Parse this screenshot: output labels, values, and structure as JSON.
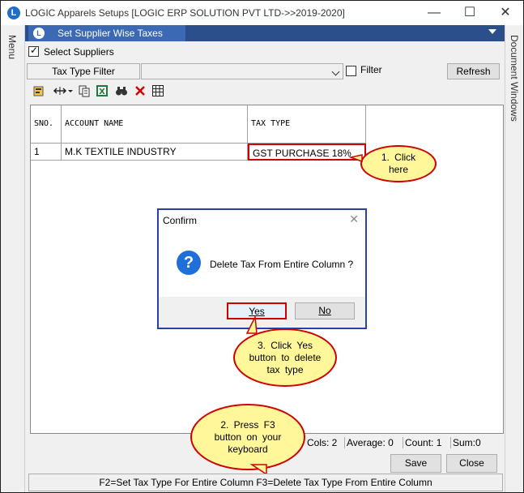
{
  "window": {
    "title": "LOGIC Apparels Setups  [LOGIC ERP SOLUTION PVT LTD->>2019-2020]",
    "app_icon": "L",
    "minimize": "—",
    "maximize": "☐",
    "close": "✕"
  },
  "sidebar_left": {
    "label": "Menu"
  },
  "sidebar_right": {
    "label": "Document Windows"
  },
  "tab": {
    "label": "Set Supplier Wise Taxes",
    "icon": "L"
  },
  "options": {
    "select_suppliers": "Select Suppliers",
    "select_suppliers_checked": true,
    "tax_type_filter": "Tax Type Filter",
    "filter_label": "Filter",
    "filter_checked": false,
    "refresh": "Refresh"
  },
  "toolbar": {
    "icons": [
      "edit-icon",
      "column-width-icon",
      "copy-icon",
      "excel-icon",
      "find-icon",
      "delete-icon",
      "grid-icon"
    ]
  },
  "grid": {
    "headers": [
      "SNO.",
      "ACCOUNT NAME",
      "TAX TYPE"
    ],
    "rows": [
      {
        "sno": "1",
        "account": "M.K TEXTILE INDUSTRY",
        "tax": "GST PURCHASE 18%"
      }
    ]
  },
  "dialog": {
    "title": "Confirm",
    "message": "Delete Tax From Entire Column ?",
    "yes": "Yes",
    "no": "No",
    "icon": "?"
  },
  "status": {
    "cols": "Cols: 2",
    "average": "Average: 0",
    "count": "Count: 1",
    "sum": "Sum:0"
  },
  "buttons": {
    "save": "Save",
    "close": "Close"
  },
  "footer": {
    "hint": "F2=Set Tax Type For Entire Column  F3=Delete Tax Type From Entire Column"
  },
  "callouts": {
    "c1": "1.  Click here",
    "c2": "2.  Press  F3 button  on  your keyboard",
    "c3": "3.  Click  Yes button  to  delete tax  type"
  },
  "colors": {
    "accent_tab": "#3c69b4",
    "tabstrip": "#2b4f8a",
    "highlight": "#d00000",
    "callout_fill": "#fff79a",
    "dialog_border": "#2741a8"
  }
}
